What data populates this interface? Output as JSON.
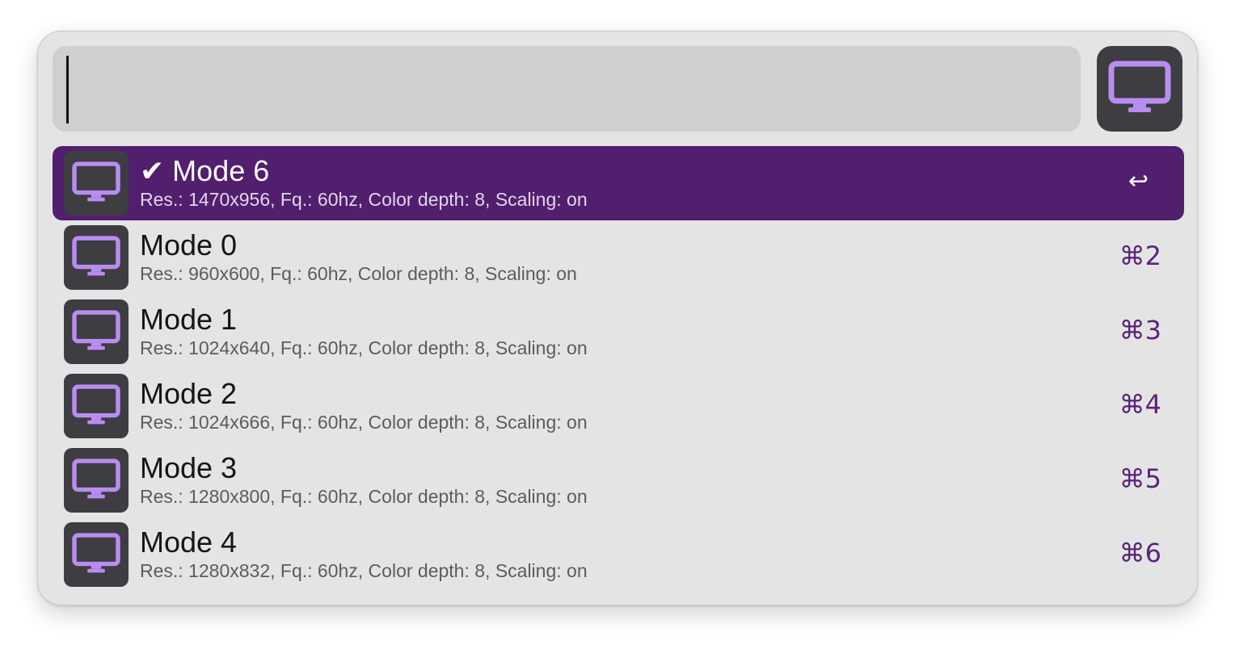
{
  "search": {
    "value": "",
    "placeholder": ""
  },
  "colors": {
    "accent": "#521e6e",
    "icon_purple": "#b98df0",
    "icon_bg": "#3d3d42"
  },
  "app_icon": "monitor-icon",
  "results": [
    {
      "title": "✔ Mode 6",
      "subtitle": "Res.: 1470x956, Fq.: 60hz, Color depth: 8, Scaling: on",
      "shortcut": "↩",
      "selected": true,
      "icon": "monitor-icon"
    },
    {
      "title": "Mode 0",
      "subtitle": "Res.: 960x600, Fq.: 60hz, Color depth: 8, Scaling: on",
      "shortcut": "⌘2",
      "selected": false,
      "icon": "monitor-icon"
    },
    {
      "title": "Mode 1",
      "subtitle": "Res.: 1024x640, Fq.: 60hz, Color depth: 8, Scaling: on",
      "shortcut": "⌘3",
      "selected": false,
      "icon": "monitor-icon"
    },
    {
      "title": "Mode 2",
      "subtitle": "Res.: 1024x666, Fq.: 60hz, Color depth: 8, Scaling: on",
      "shortcut": "⌘4",
      "selected": false,
      "icon": "monitor-icon"
    },
    {
      "title": "Mode 3",
      "subtitle": "Res.: 1280x800, Fq.: 60hz, Color depth: 8, Scaling: on",
      "shortcut": "⌘5",
      "selected": false,
      "icon": "monitor-icon"
    },
    {
      "title": "Mode 4",
      "subtitle": "Res.: 1280x832, Fq.: 60hz, Color depth: 8, Scaling: on",
      "shortcut": "⌘6",
      "selected": false,
      "icon": "monitor-icon"
    }
  ]
}
